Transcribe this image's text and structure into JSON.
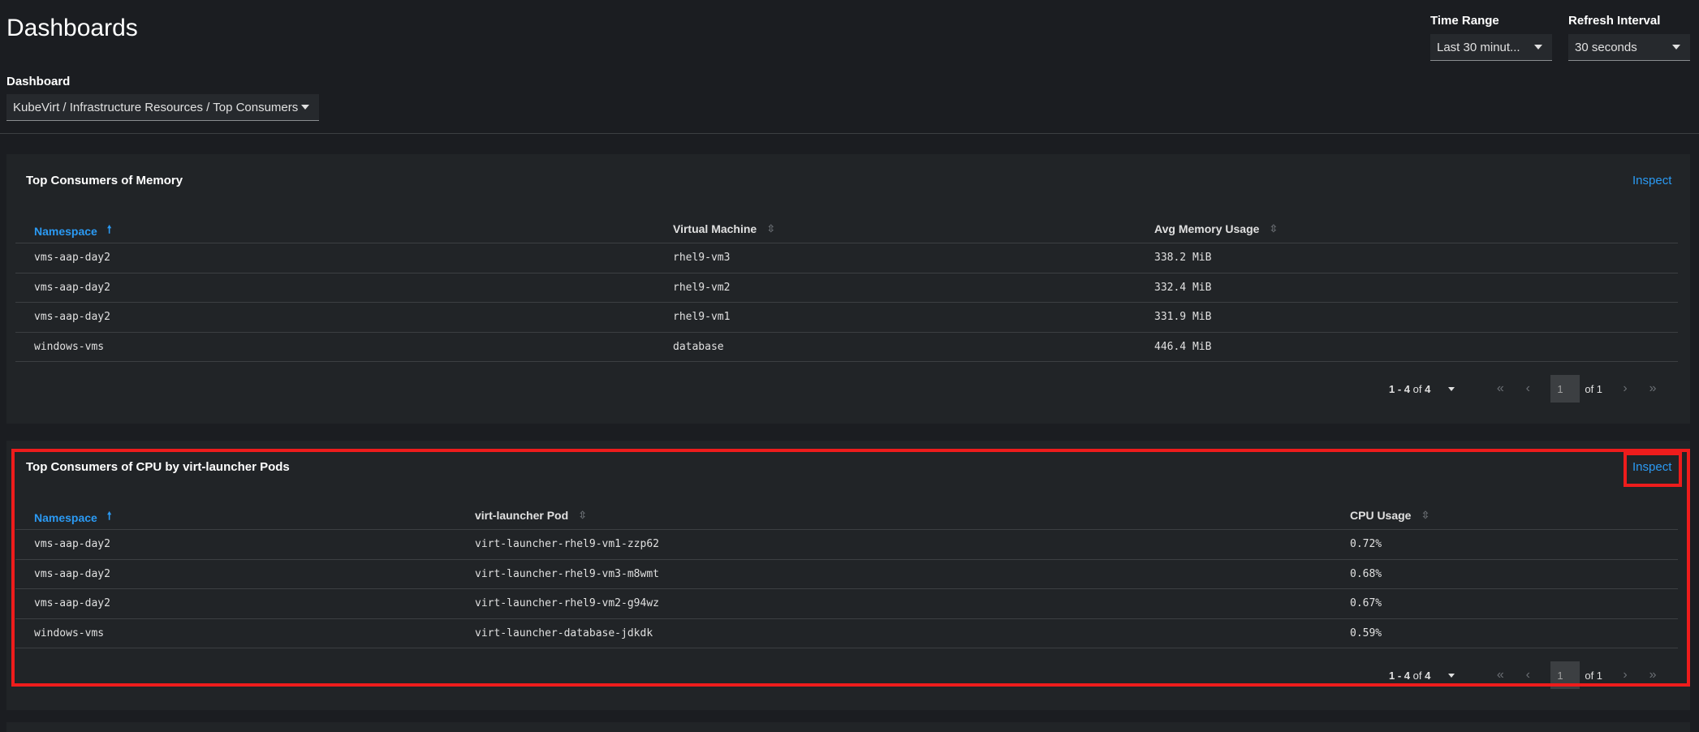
{
  "page": {
    "title": "Dashboards"
  },
  "controls": {
    "time_range": {
      "label": "Time Range",
      "value": "Last 30 minut..."
    },
    "refresh_interval": {
      "label": "Refresh Interval",
      "value": "30 seconds"
    },
    "dashboard": {
      "label": "Dashboard",
      "value": "KubeVirt / Infrastructure Resources / Top Consumers"
    }
  },
  "memory_panel": {
    "title": "Top Consumers of Memory",
    "inspect": "Inspect",
    "columns": [
      "Namespace",
      "Virtual Machine",
      "Avg Memory Usage"
    ],
    "rows": [
      [
        "vms-aap-day2",
        "rhel9-vm3",
        "338.2 MiB"
      ],
      [
        "vms-aap-day2",
        "rhel9-vm2",
        "332.4 MiB"
      ],
      [
        "vms-aap-day2",
        "rhel9-vm1",
        "331.9 MiB"
      ],
      [
        "windows-vms",
        "database",
        "446.4 MiB"
      ]
    ],
    "pagination": {
      "range": "1 - 4",
      "of_label": "of",
      "total": "4",
      "page": "1",
      "of_pages": "of 1"
    }
  },
  "cpu_panel": {
    "title": "Top Consumers of CPU by virt-launcher Pods",
    "inspect": "Inspect",
    "columns": [
      "Namespace",
      "virt-launcher Pod",
      "CPU Usage"
    ],
    "rows": [
      [
        "vms-aap-day2",
        "virt-launcher-rhel9-vm1-zzp62",
        "0.72%"
      ],
      [
        "vms-aap-day2",
        "virt-launcher-rhel9-vm3-m8wmt",
        "0.68%"
      ],
      [
        "vms-aap-day2",
        "virt-launcher-rhel9-vm2-g94wz",
        "0.67%"
      ],
      [
        "windows-vms",
        "virt-launcher-database-jdkdk",
        "0.59%"
      ]
    ],
    "pagination": {
      "range": "1 - 4",
      "of_label": "of",
      "total": "4",
      "page": "1",
      "of_pages": "of 1"
    }
  },
  "icons": {
    "sort_asc": "arrow-up-icon",
    "sort": "sort-icon",
    "dropdown": "caret-down-icon",
    "first": "angle-double-left-icon",
    "prev": "angle-left-icon",
    "next": "angle-right-icon",
    "last": "angle-double-right-icon"
  },
  "colors": {
    "accent": "#2b9af3",
    "highlight": "#ee1c1c",
    "background": "#1b1d21",
    "panel": "#212427"
  }
}
